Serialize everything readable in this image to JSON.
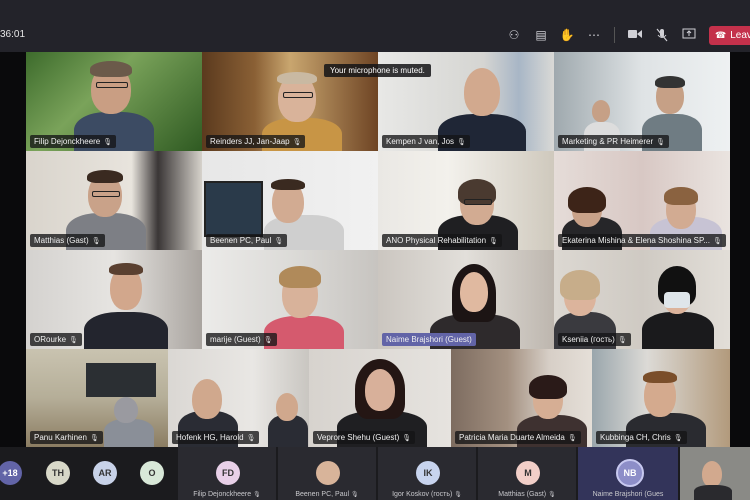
{
  "toolbar": {
    "timer": "36:01",
    "leave_label": "Leave",
    "icons": [
      "participants-icon",
      "chat-icon",
      "raise-hand-icon",
      "more-actions-icon",
      "camera-icon",
      "microphone-muted-icon",
      "share-screen-icon"
    ]
  },
  "notification": "Your microphone is muted.",
  "tiles": [
    {
      "name": "Filip Dejonckheere",
      "mic": true
    },
    {
      "name": "Reinders JJ, Jan-Jaap",
      "mic": true
    },
    {
      "name": "Kempen J van, Jos",
      "mic": true
    },
    {
      "name": "Marketing & PR Heimerer",
      "mic": true
    },
    {
      "name": "Matthias (Gast)",
      "mic": true
    },
    {
      "name": "Beenen PC, Paul",
      "mic": true
    },
    {
      "name": "ANO Physical Rehabilitation",
      "mic": true
    },
    {
      "name": "Ekaterina Mishina & Elena Shoshina SP...",
      "mic": true
    },
    {
      "name": "ORourke",
      "mic": true
    },
    {
      "name": "marije (Guest)",
      "mic": true
    },
    {
      "name": "Naime Brajshori (Guest)",
      "mic": false,
      "active": true
    },
    {
      "name": "Kseniia (гость)",
      "mic": true
    },
    {
      "name": "Panu Karhinen",
      "mic": true
    },
    {
      "name": "Hofenk HG, Harold",
      "mic": true
    },
    {
      "name": "Veprore Shehu (Guest)",
      "mic": true
    },
    {
      "name": "Patricia Maria Duarte Almeida",
      "mic": true
    },
    {
      "name": "Kubbinga CH, Chris",
      "mic": true
    }
  ],
  "roster": {
    "overflow": "+18",
    "avatars": [
      "TH",
      "AR",
      "O"
    ],
    "participants": [
      {
        "initials": "FD",
        "name": "Filip Dejonckheere"
      },
      {
        "initials": "",
        "name": "Beenen PC, Paul"
      },
      {
        "initials": "IK",
        "name": "Igor Koskov (гость)"
      },
      {
        "initials": "M",
        "name": "Matthias (Gast)"
      },
      {
        "initials": "NB",
        "name": "Naime Brajshori (Gues"
      }
    ]
  }
}
